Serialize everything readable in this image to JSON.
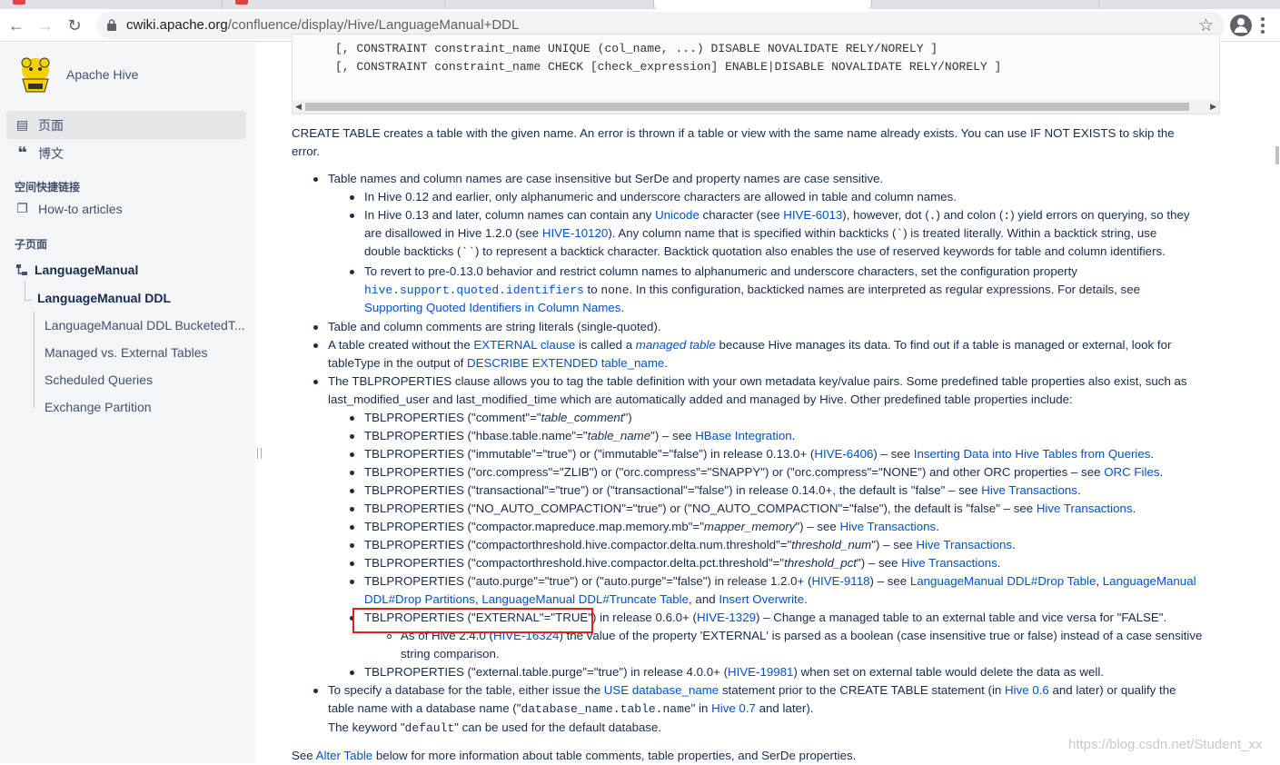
{
  "browser": {
    "url_host": "cwiki.apache.org",
    "url_path": "/confluence/display/Hive/LanguageManual+DDL"
  },
  "sidebar": {
    "space_name": "Apache Hive",
    "nav": [
      {
        "label": "页面",
        "icon": "pages-icon"
      },
      {
        "label": "博文",
        "icon": "blog-quote-icon"
      }
    ],
    "shortcuts_heading": "空间快捷链接",
    "shortcut": {
      "label": "How-to articles",
      "icon": "copy-icon"
    },
    "children_heading": "子页面",
    "tree": {
      "root": "LanguageManual",
      "current": "LanguageManual DDL",
      "children": [
        "LanguageManual DDL BucketedT...",
        "Managed vs. External Tables",
        "Scheduled Queries",
        "Exchange Partition"
      ]
    }
  },
  "code": {
    "lines": [
      "[, CONSTRAINT constraint_name UNIQUE (col_name, ...) DISABLE NOVALIDATE RELY/NORELY ]",
      "[, CONSTRAINT constraint_name CHECK [check_expression] ENABLE|DISABLE NOVALIDATE RELY/NORELY ]"
    ]
  },
  "intro": {
    "l1": "CREATE TABLE creates a table with the given name. An error is thrown if a table or view with the same name already exists. You can use IF NOT EXISTS to skip the",
    "l2": "error."
  },
  "b1": {
    "text": "Table names and column names are case insensitive but SerDe and property names are case sensitive.",
    "s1": "In Hive 0.12 and earlier, only alphanumeric and underscore characters are allowed in table and column names.",
    "s2a": "In Hive 0.13 and later, column names can contain any ",
    "s2_unicode": "Unicode",
    "s2b": " character (see ",
    "s2_hive6013": "HIVE-6013",
    "s2c": "), however, dot (",
    "s2_dot": ".",
    "s2d": ") and colon (",
    "s2_colon": ":",
    "s2e": ") yield errors on querying, so they",
    "s2f": "are disallowed in Hive 1.2.0 (see ",
    "s2_hive10120": "HIVE-10120",
    "s2g": "). Any column name that is specified within backticks (",
    "s2_bt": "`",
    "s2h": ") is treated literally. Within a backtick string, use",
    "s2i": "double backticks (",
    "s2_dbt": "``",
    "s2j": ") to represent a backtick character. Backtick quotation also enables the use of reserved keywords for table and column identifiers.",
    "s3a": "To revert to pre-0.13.0 behavior and restrict column names to alphanumeric and underscore characters, set the configuration property",
    "s3_prop": "hive.support.quoted.identifiers",
    "s3b": " to ",
    "s3_none": "none",
    "s3c": ". In this configuration, backticked names are interpreted as regular expressions. For details, see",
    "s3_link": "Supporting Quoted Identifiers in Column Names",
    "s3d": "."
  },
  "b2": "Table and column comments are string literals (single-quoted).",
  "b3": {
    "a": "A table created without the ",
    "ext": "EXTERNAL clause",
    "b": " is called a ",
    "managed": "managed table",
    "c": " because Hive manages its data. To find out if a table is managed or external, look for",
    "d": "tableType in the output of ",
    "desc": "DESCRIBE EXTENDED table_name",
    "e": "."
  },
  "b4": {
    "l1": "The TBLPROPERTIES clause allows you to tag the table definition with your own metadata key/value pairs. Some predefined table properties also exist, such as",
    "l2": "last_modified_user and last_modified_time which are automatically added and managed by Hive. Other predefined table properties include:",
    "p1a": "TBLPROPERTIES (\"comment\"=\"",
    "p1i": "table_comment",
    "p1b": "\")",
    "p2a": "TBLPROPERTIES (\"hbase.table.name\"=\"",
    "p2i": "table_name",
    "p2b": "\") – see ",
    "p2l": "HBase Integration",
    "p2c": ".",
    "p3a": "TBLPROPERTIES (\"immutable\"=\"true\") or (\"immutable\"=\"false\") in release 0.13.0+ (",
    "p3l1": "HIVE-6406",
    "p3b": ") – see ",
    "p3l2": "Inserting Data into Hive Tables from Queries",
    "p3c": ".",
    "p4a": "TBLPROPERTIES (\"orc.compress\"=\"ZLIB\") or (\"orc.compress\"=\"SNAPPY\") or (\"orc.compress\"=\"NONE\") and other ORC properties – see ",
    "p4l": "ORC Files",
    "p4b": ".",
    "p5a": "TBLPROPERTIES (\"transactional\"=\"true\") or (\"transactional\"=\"false\") in release 0.14.0+, the default is \"false\" – see ",
    "p5l": "Hive Transactions",
    "p5b": ".",
    "p6a": "TBLPROPERTIES (\"NO_AUTO_COMPACTION\"=\"true\") or (\"NO_AUTO_COMPACTION\"=\"false\"), the default is \"false\" – see ",
    "p6l": "Hive Transactions",
    "p6b": ".",
    "p7a": "TBLPROPERTIES (\"compactor.mapreduce.map.memory.mb\"=\"",
    "p7i": "mapper_memory",
    "p7b": "\") – see ",
    "p7l": "Hive Transactions",
    "p7c": ".",
    "p8a": "TBLPROPERTIES (\"compactorthreshold.hive.compactor.delta.num.threshold\"=\"",
    "p8i": "threshold_num",
    "p8b": "\") – see ",
    "p8l": "Hive Transactions",
    "p8c": ".",
    "p9a": "TBLPROPERTIES (\"compactorthreshold.hive.compactor.delta.pct.threshold\"=\"",
    "p9i": "threshold_pct",
    "p9b": "\") – see ",
    "p9l": "Hive Transactions",
    "p9c": ".",
    "p10a": "TBLPROPERTIES (\"auto.purge\"=\"true\") or (\"auto.purge\"=\"false\") in release 1.2.0+ (",
    "p10l1": "HIVE-9118",
    "p10b": ") – see ",
    "p10l2": "LanguageManual DDL#Drop Table",
    "p10c": ", ",
    "p10l3a": "LanguageManual",
    "p10l3b": "DDL#Drop Partitions",
    "p10d": ", ",
    "p10l4": "LanguageManual DDL#Truncate Table",
    "p10e": ", and ",
    "p10l5": "Insert Overwrite",
    "p10f": ".",
    "p11a": "TBLPROPERTIES (\"EXTERNAL\"=\"TRUE\") in release 0.6.0+ (",
    "p11l": "HIVE-1329",
    "p11b": ") – Change a managed table to an external table and vice versa for \"FALSE\".",
    "p11s1a": "As of Hive 2.4.0 (",
    "p11s1l": "HIVE-16324",
    "p11s1b": ") the value of the property 'EXTERNAL' is parsed as a boolean (case insensitive true or false) instead of a case sensitive",
    "p11s2": "string comparison.",
    "p12a": "TBLPROPERTIES (\"external.table.purge\"=\"true\") in release 4.0.0+ (",
    "p12l": "HIVE-19981",
    "p12b": ") when set on external table would delete the data as well."
  },
  "b5": {
    "a": "To specify a database for the table, either issue the ",
    "use": "USE database_name",
    "b": " statement prior to the CREATE TABLE statement (in ",
    "h06": "Hive 0.6",
    "c": " and later) or qualify the",
    "d": "table name with a database name (\"",
    "dbn": "database_name.table.name",
    "e": "\" in ",
    "h07": "Hive 0.7",
    "f": " and later).",
    "g": "The keyword \"",
    "def": "default",
    "h": "\" can be used for the default database."
  },
  "footer": {
    "a": "See ",
    "alter": "Alter Table",
    "b": " below for more information about table comments, table properties, and SerDe properties."
  },
  "watermark": "https://blog.csdn.net/Student_xx"
}
